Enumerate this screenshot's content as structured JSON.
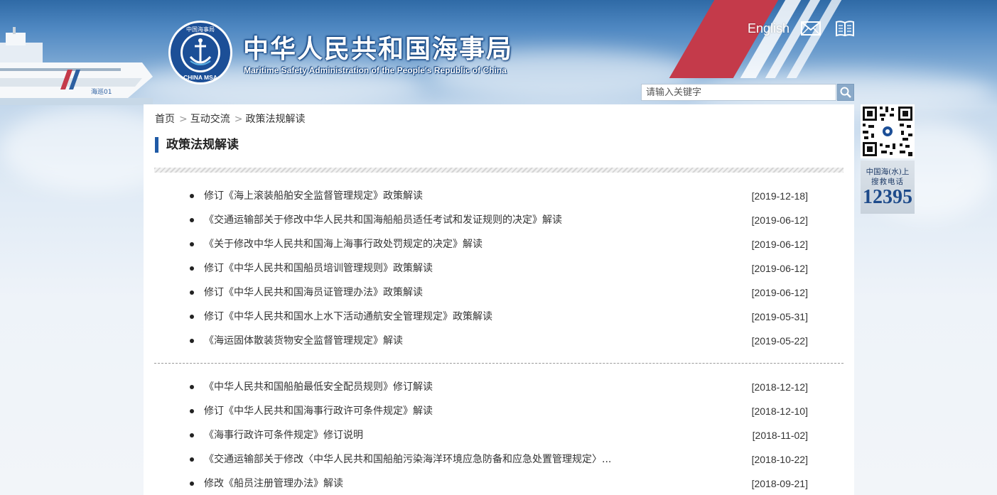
{
  "header": {
    "title_cn": "中华人民共和国海事局",
    "title_en": "Maritime Safety Administration of the People's Republic of China",
    "emblem_text_top": "中国海事局",
    "emblem_text_bottom": "CHINA MSA",
    "ship_label": "海巡01",
    "english_link": "English",
    "mail_icon": "mail-icon",
    "book_icon": "book-icon"
  },
  "search": {
    "placeholder": "请输入关键字",
    "icon": "search-icon"
  },
  "breadcrumb": {
    "home": "首页",
    "level1": "互动交流",
    "current": "政策法规解读",
    "separator": ">"
  },
  "section": {
    "title": "政策法规解读"
  },
  "news_group_1": [
    {
      "title": "修订《海上滚装船舶安全监督管理规定》政策解读",
      "date": "[2019-12-18]"
    },
    {
      "title": "《交通运输部关于修改中华人民共和国海船船员适任考试和发证规则的决定》解读",
      "date": "[2019-06-12]"
    },
    {
      "title": "《关于修改中华人民共和国海上海事行政处罚规定的决定》解读",
      "date": "[2019-06-12]"
    },
    {
      "title": "修订《中华人民共和国船员培训管理规则》政策解读",
      "date": "[2019-06-12]"
    },
    {
      "title": "修订《中华人民共和国海员证管理办法》政策解读",
      "date": "[2019-06-12]"
    },
    {
      "title": "修订《中华人民共和国水上水下活动通航安全管理规定》政策解读",
      "date": "[2019-05-31]"
    },
    {
      "title": "《海运固体散装货物安全监督管理规定》解读",
      "date": "[2019-05-22]"
    }
  ],
  "news_group_2": [
    {
      "title": "《中华人民共和国船舶最低安全配员规则》修订解读",
      "date": "[2018-12-12]"
    },
    {
      "title": "修订《中华人民共和国海事行政许可条件规定》解读",
      "date": "[2018-12-10]"
    },
    {
      "title": "《海事行政许可条件规定》修订说明",
      "date": "[2018-11-02]"
    },
    {
      "title": "《交通运输部关于修改〈中华人民共和国船舶污染海洋环境应急防备和应急处置管理规定〉...",
      "date": "[2018-10-22]"
    },
    {
      "title": "修改《船员注册管理办法》解读",
      "date": "[2018-09-21]"
    }
  ],
  "sidebar": {
    "qr_icon": "qr-code-icon",
    "hotline_line1": "中国海(水)上",
    "hotline_line2": "搜救电话",
    "hotline_number": "12395"
  },
  "colors": {
    "accent": "#1f5aa6",
    "header_blue": "#2f6aa6",
    "stripe_red": "#c43a4a"
  }
}
